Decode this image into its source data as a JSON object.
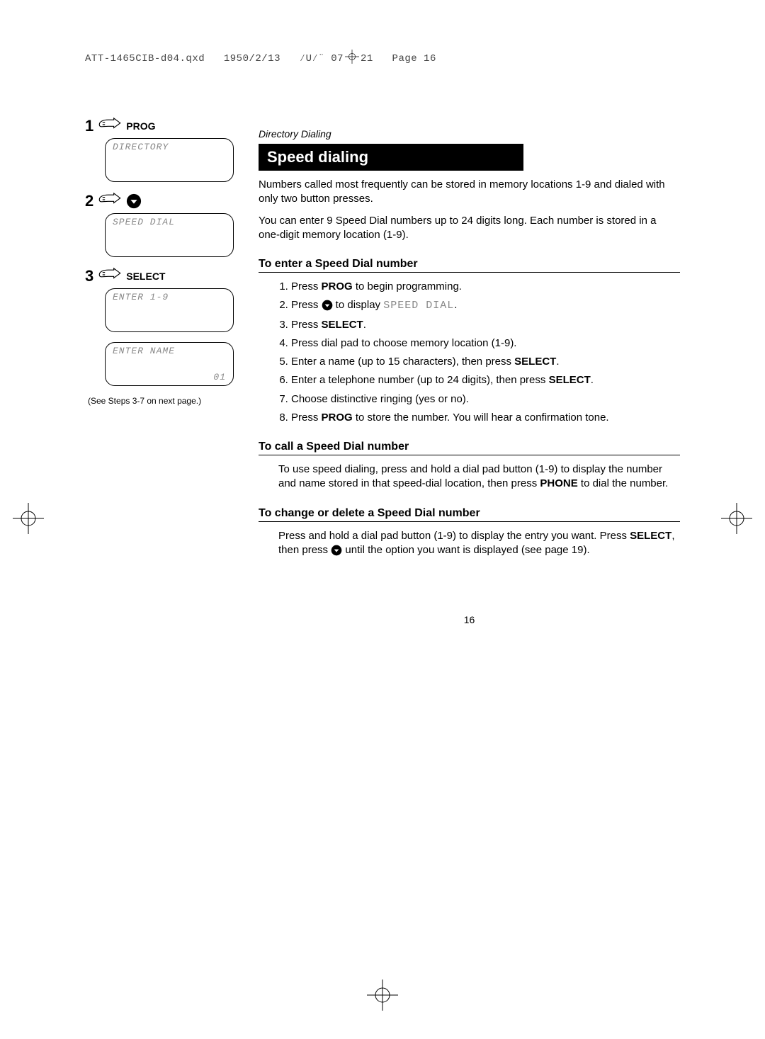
{
  "header_meta": {
    "filename": "ATT-1465CIB-d04.qxd",
    "date": "1950/2/13",
    "mid": "⁄U⁄¨ 07",
    "after_mark": "21",
    "page_label": "Page 16"
  },
  "sidebar": {
    "steps": [
      {
        "num": "1",
        "label": "PROG",
        "lcd": "DIRECTORY",
        "show_hand": true,
        "show_round": false
      },
      {
        "num": "2",
        "label": "",
        "lcd": "SPEED DIAL",
        "show_hand": true,
        "show_round": true
      },
      {
        "num": "3",
        "label": "SELECT",
        "lcd": "ENTER 1-9",
        "show_hand": true,
        "show_round": false
      }
    ],
    "lcd_name_line1": "ENTER NAME",
    "lcd_name_line2": "01",
    "note": "(See Steps 3-7 on next page.)"
  },
  "main": {
    "section_tag": "Directory Dialing",
    "title": "Speed dialing",
    "intro1": "Numbers called most frequently can be stored in memory locations 1-9 and dialed with only two button presses.",
    "intro2": "You can enter 9 Speed Dial numbers up to 24 digits long. Each number is stored in a one-digit memory location (1-9).",
    "sub_enter": "To enter a Speed Dial number",
    "steps_enter": {
      "s1_a": "Press ",
      "s1_b": "PROG",
      "s1_c": " to begin programming.",
      "s2_a": "Press ",
      "s2_b": " to display ",
      "s2_c": "SPEED DIAL",
      "s2_d": ".",
      "s3_a": "Press ",
      "s3_b": "SELECT",
      "s3_c": ".",
      "s4": "Press dial pad to choose memory location (1-9).",
      "s5_a": "Enter a name (up to 15 characters), then press ",
      "s5_b": "SELECT",
      "s5_c": ".",
      "s6_a": "Enter a telephone number (up to 24 digits), then press ",
      "s6_b": "SELECT",
      "s6_c": ".",
      "s7": "Choose distinctive ringing (yes or no).",
      "s8_a": "Press ",
      "s8_b": "PROG",
      "s8_c": " to store the number. You will hear a confirmation tone."
    },
    "sub_call": "To call a Speed Dial number",
    "call_a": "To use speed dialing, press and hold a dial pad button (1-9) to display the number and name stored in that speed-dial location, then press ",
    "call_b": "PHONE",
    "call_c": " to dial the number.",
    "sub_change": "To change or delete a Speed Dial number",
    "change_a": "Press and hold a dial pad button (1-9) to display the entry you want. Press ",
    "change_b": "SELECT",
    "change_c": ", then press ",
    "change_d": " until the option you want is displayed (see page 19).",
    "page_number": "16"
  }
}
